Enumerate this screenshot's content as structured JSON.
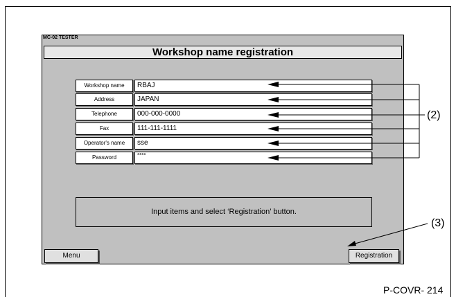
{
  "app": {
    "label": "MC-02 TESTER",
    "title": "Workshop name registration"
  },
  "form": {
    "fields": [
      {
        "label": "Workshop name",
        "value": "RBAJ"
      },
      {
        "label": "Address",
        "value": "JAPAN"
      },
      {
        "label": "Telephone",
        "value": "000-000-0000"
      },
      {
        "label": "Fax",
        "value": "111-111-1111"
      },
      {
        "label": "Operator's name",
        "value": "sse"
      },
      {
        "label": "Password",
        "value": "****"
      }
    ]
  },
  "message": "Input items and select ‘Registration’ button.",
  "buttons": {
    "menu": "Menu",
    "registration": "Registration"
  },
  "annotations": {
    "callout_2": "(2)",
    "callout_3": "(3)",
    "page_code": "P-COVR- 214"
  }
}
